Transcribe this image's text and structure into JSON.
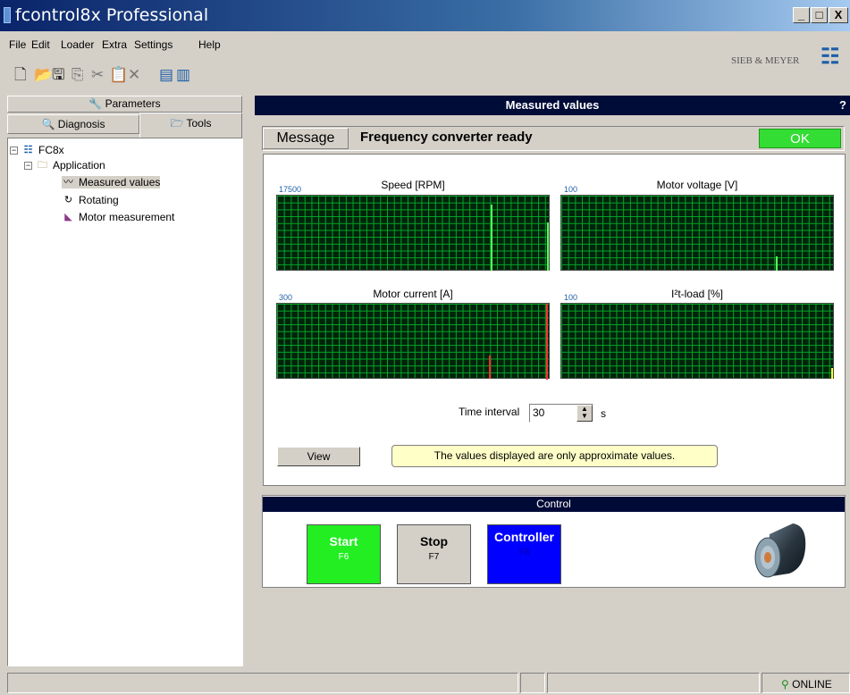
{
  "window": {
    "title": "fcontrol8x Professional",
    "min": "_",
    "max": "□",
    "close": "X"
  },
  "menu": [
    "File",
    "Edit",
    "Loader",
    "Extra",
    "Settings",
    "Help"
  ],
  "brand": "SIEB & MEYER",
  "left_tabs": {
    "parameters": "Parameters",
    "diagnosis": "Diagnosis",
    "tools": "Tools"
  },
  "tree": {
    "root": "FC8x",
    "application": "Application",
    "items": [
      "Measured values",
      "Rotating",
      "Motor measurement"
    ]
  },
  "main": {
    "title": "Measured values",
    "help": "?",
    "message_label": "Message",
    "message_text": "Frequency converter ready",
    "status": "OK",
    "charts": [
      {
        "title": "Speed [RPM]",
        "max": "17500"
      },
      {
        "title": "Motor voltage [V]",
        "max": "100"
      },
      {
        "title": "Motor current [A]",
        "max": "300"
      },
      {
        "title": "I²t-load [%]",
        "max": "100"
      }
    ],
    "time_interval_label": "Time interval",
    "time_interval_value": "30",
    "time_unit": "s",
    "view_button": "View",
    "note": "The values displayed are only approximate values."
  },
  "control": {
    "title": "Control",
    "start": {
      "label": "Start",
      "key": "F6",
      "color": "#22ee22"
    },
    "stop": {
      "label": "Stop",
      "key": "F7",
      "color": "#d4d0c8"
    },
    "controller": {
      "label": "Controller",
      "key": "F8",
      "color": "#0000ff"
    }
  },
  "status": {
    "online": "ONLINE"
  }
}
